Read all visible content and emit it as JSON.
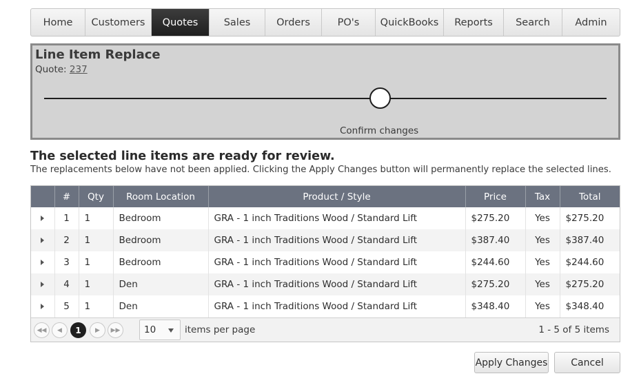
{
  "nav": {
    "items": [
      "Home",
      "Customers",
      "Quotes",
      "Sales",
      "Orders",
      "PO's",
      "QuickBooks",
      "Reports",
      "Search",
      "Admin"
    ],
    "active": "Quotes"
  },
  "panel": {
    "title": "Line Item Replace",
    "quote_label": "Quote:",
    "quote_number": "237",
    "step_label": "Confirm changes"
  },
  "review": {
    "title": "The selected line items are ready for review.",
    "subtitle": "The replacements below have not been applied. Clicking the Apply Changes button will permanently replace the selected lines."
  },
  "grid": {
    "columns": [
      "#",
      "Qty",
      "Room Location",
      "Product / Style",
      "Price",
      "Tax",
      "Total"
    ],
    "rows": [
      {
        "num": "1",
        "qty": "1",
        "room": "Bedroom",
        "product": "GRA - 1 inch Traditions Wood / Standard Lift",
        "price": "$275.20",
        "tax": "Yes",
        "total": "$275.20"
      },
      {
        "num": "2",
        "qty": "1",
        "room": "Bedroom",
        "product": "GRA - 1 inch Traditions Wood / Standard Lift",
        "price": "$387.40",
        "tax": "Yes",
        "total": "$387.40"
      },
      {
        "num": "3",
        "qty": "1",
        "room": "Bedroom",
        "product": "GRA - 1 inch Traditions Wood / Standard Lift",
        "price": "$244.60",
        "tax": "Yes",
        "total": "$244.60"
      },
      {
        "num": "4",
        "qty": "1",
        "room": "Den",
        "product": "GRA - 1 inch Traditions Wood / Standard Lift",
        "price": "$275.20",
        "tax": "Yes",
        "total": "$275.20"
      },
      {
        "num": "5",
        "qty": "1",
        "room": "Den",
        "product": "GRA - 1 inch Traditions Wood / Standard Lift",
        "price": "$348.40",
        "tax": "Yes",
        "total": "$348.40"
      }
    ]
  },
  "pager": {
    "current_page": "1",
    "page_size": "10",
    "per_page_label": "items per page",
    "info": "1 - 5 of 5 items"
  },
  "buttons": {
    "apply": "Apply Changes",
    "cancel": "Cancel"
  }
}
